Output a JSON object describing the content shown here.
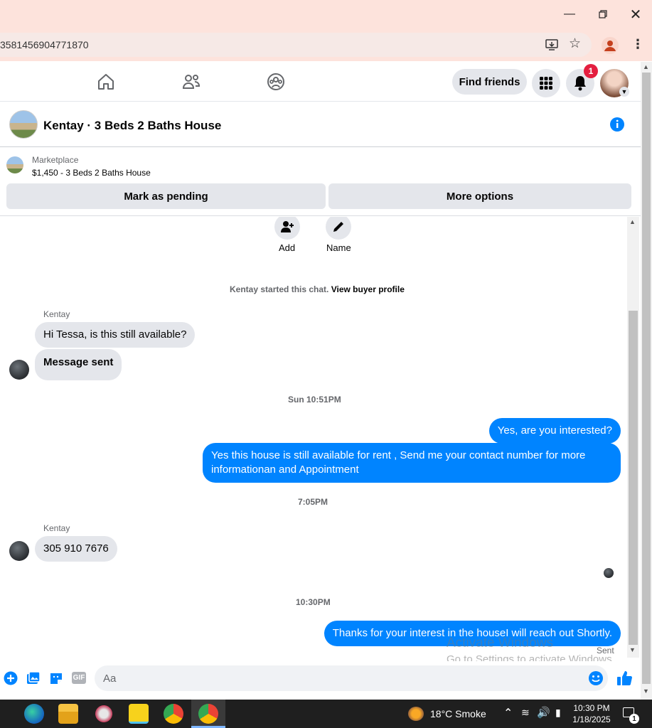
{
  "browser": {
    "url_fragment": "3581456904771870",
    "window_controls": {
      "minimize": "minimize-icon",
      "restore": "restore-icon",
      "close": "close-icon"
    }
  },
  "nav": {
    "find_friends_label": "Find friends",
    "notification_count": "1",
    "icons": [
      "home-icon",
      "friends-icon",
      "groups-icon",
      "menu-grid-icon",
      "bell-icon"
    ]
  },
  "chat": {
    "title": "Kentay · 3 Beds 2 Baths House",
    "marketplace_label": "Marketplace",
    "listing": "$1,450 - 3 Beds 2 Baths House",
    "mark_pending_label": "Mark as pending",
    "more_options_label": "More options",
    "add_label": "Add",
    "name_label": "Name",
    "started_text": "Kentay started this chat.",
    "view_profile_link": "View buyer profile"
  },
  "messages": [
    {
      "sender": "Kentay",
      "text": "Hi Tessa, is this still available?",
      "direction": "in"
    },
    {
      "sender": "Kentay",
      "text": "Message sent",
      "direction": "in"
    },
    {
      "timestamp": "Sun 10:51PM"
    },
    {
      "text": "Yes, are you interested?",
      "direction": "out"
    },
    {
      "text": "Yes this house is still available for rent , Send me your contact number for more informationan and Appointment",
      "direction": "out"
    },
    {
      "timestamp": "7:05PM"
    },
    {
      "sender": "Kentay",
      "text": "305 910 7676",
      "direction": "in"
    },
    {
      "timestamp": "10:30PM"
    },
    {
      "text": "Thanks for your interest in the houseI will reach out Shortly.",
      "direction": "out",
      "status": "Sent"
    }
  ],
  "composer": {
    "placeholder": "Aa",
    "gif_label": "GIF"
  },
  "watermark": {
    "line1": "Activate Windows",
    "line2": "Go to Settings to activate Windows."
  },
  "taskbar": {
    "weather": "18°C  Smoke",
    "time": "10:30 PM",
    "date": "1/18/2025",
    "notif_count": "1"
  },
  "colors": {
    "accent": "#0084ff",
    "badge": "#e41e3f",
    "titlebar": "#fde3dc"
  }
}
